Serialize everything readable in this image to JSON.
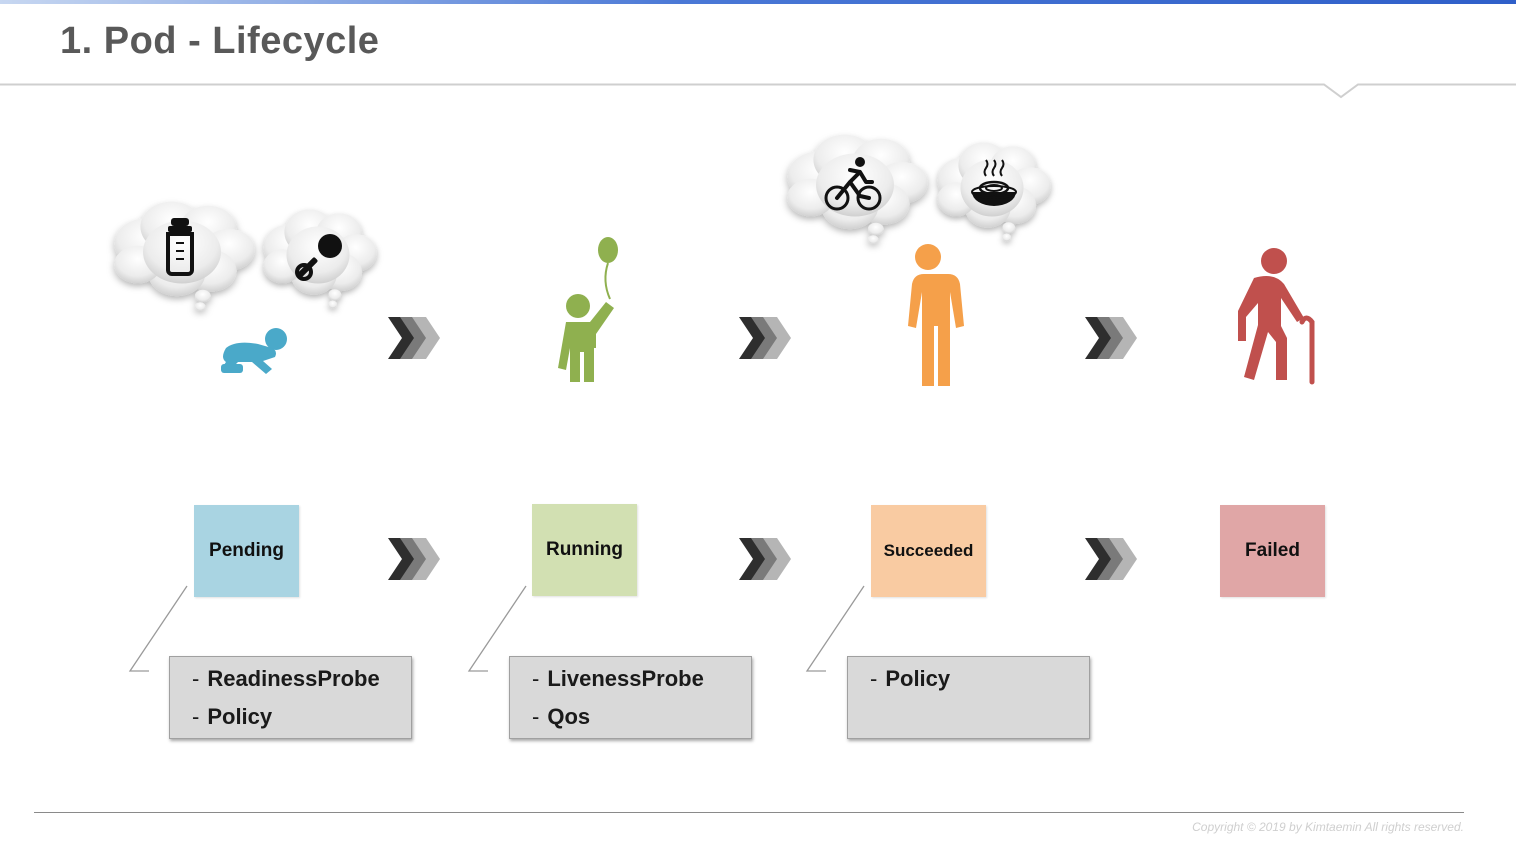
{
  "slide": {
    "title": "1. Pod - Lifecycle",
    "copyright": "Copyright © 2019 by Kimtaemin All rights reserved."
  },
  "stages": [
    {
      "label": "Pending",
      "color": "#a9d4e2",
      "figure": "crawling-baby-icon",
      "figure_color": "#4aa9c9",
      "thoughts": [
        "baby-bottle-icon",
        "rattle-icon"
      ],
      "details": [
        "ReadinessProbe",
        "Policy"
      ]
    },
    {
      "label": "Running",
      "color": "#d2e0b2",
      "figure": "child-with-balloon-icon",
      "figure_color": "#8fb04f",
      "thoughts": [],
      "details": [
        "LivenessProbe",
        "Qos"
      ]
    },
    {
      "label": "Succeeded",
      "color": "#f9cba2",
      "figure": "adult-person-icon",
      "figure_color": "#f5a04a",
      "thoughts": [
        "cyclist-icon",
        "hot-food-bowl-icon"
      ],
      "details": [
        "Policy"
      ]
    },
    {
      "label": "Failed",
      "color": "#e0a6a6",
      "figure": "elderly-person-with-cane-icon",
      "figure_color": "#c0504d",
      "thoughts": [],
      "details": []
    }
  ],
  "colors": {
    "title": "#595959",
    "arrow_dark": "#2e2e2e",
    "arrow_mid": "#7a7a7a",
    "arrow_light": "#b5b5b5",
    "detail_bg": "#d9d9d9"
  }
}
